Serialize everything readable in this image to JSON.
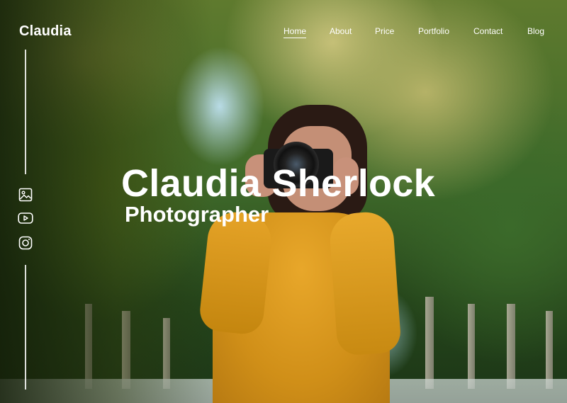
{
  "brand": {
    "logo_text": "Claudia"
  },
  "nav": {
    "items": [
      {
        "label": "Home",
        "active": true
      },
      {
        "label": "About",
        "active": false
      },
      {
        "label": "Price",
        "active": false
      },
      {
        "label": "Portfolio",
        "active": false
      },
      {
        "label": "Contact",
        "active": false
      },
      {
        "label": "Blog",
        "active": false
      }
    ]
  },
  "social": {
    "icons": [
      "image-icon",
      "youtube-icon",
      "instagram-icon"
    ]
  },
  "hero": {
    "name": "Claudia Sherlock",
    "role": "Photographer"
  },
  "colors": {
    "text": "#ffffff",
    "foliage": "#3f6a2a",
    "sweater": "#e0a027"
  }
}
